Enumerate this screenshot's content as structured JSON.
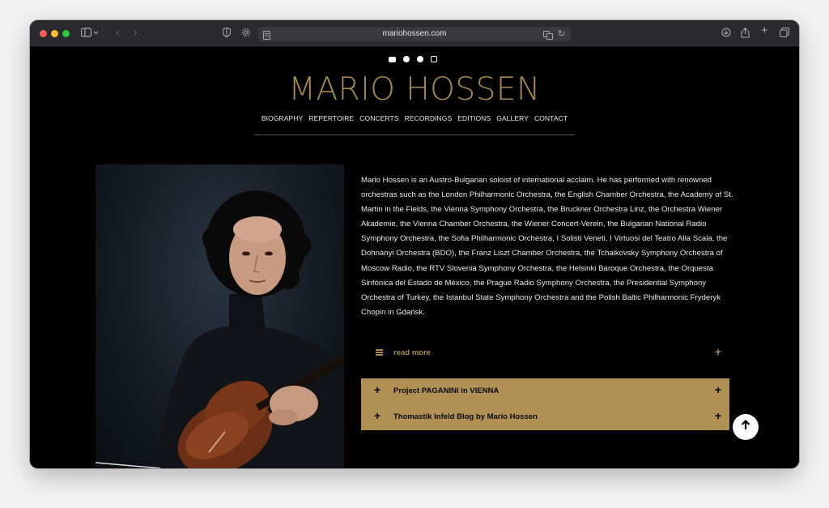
{
  "browser": {
    "url": "mariohossen.com",
    "traffic_lights": [
      "#ff5f57",
      "#febc2e",
      "#28c840"
    ]
  },
  "site": {
    "title": "MARIO HOSSEN",
    "accent_color": "#a8884f",
    "social_icons": [
      "youtube-icon",
      "spotify-icon",
      "facebook-icon",
      "instagram-icon"
    ],
    "nav": [
      "BIOGRAPHY",
      "REPERTOIRE",
      "CONCERTS",
      "RECORDINGS",
      "EDITIONS",
      "GALLERY",
      "CONTACT"
    ]
  },
  "main": {
    "bio": "Mario Hossen is an Austro-Bulgarian soloist of international acclaim. He has performed with renowned orchestras such as the London Philharmonic Orchestra, the English Chamber Orchestra, the Academy of St. Martin in the Fields, the Vienna Symphony Orchestra, the Bruckner Orchestra Linz, the Orchestra Wiener Akademie, the Vienna Chamber Orchestra, the Wiener Concert-Verein, the Bulgarian National Radio Symphony Orchestra, the Sofia Philharmonic Orchestra, I Solisti Veneti, I Virtuosi del Teatro Alla Scala, the Dohnányi Orchestra (BDO), the Franz Liszt Chamber Orchestra, the Tchaikovsky Symphony Orchestra of Moscow Radio, the RTV Slovenia Symphony Orchestra, the Helsinki Baroque Orchestra, the Orquesta Sinfónica del Estado de México, the Prague Radio Symphony Orchestra, the Presidential Symphony Orchestra of Turkey, the  Istanbul State Symphony Orchestra and the Polish Baltic Philharmonic Fryderyk Chopin in Gdańsk.",
    "read_more": "read more",
    "accordion": [
      "Project PAGANINI in VIENNA",
      "Thomastik Infeld Blog by Mario Hossen"
    ],
    "accordion_color": "#b09054"
  }
}
